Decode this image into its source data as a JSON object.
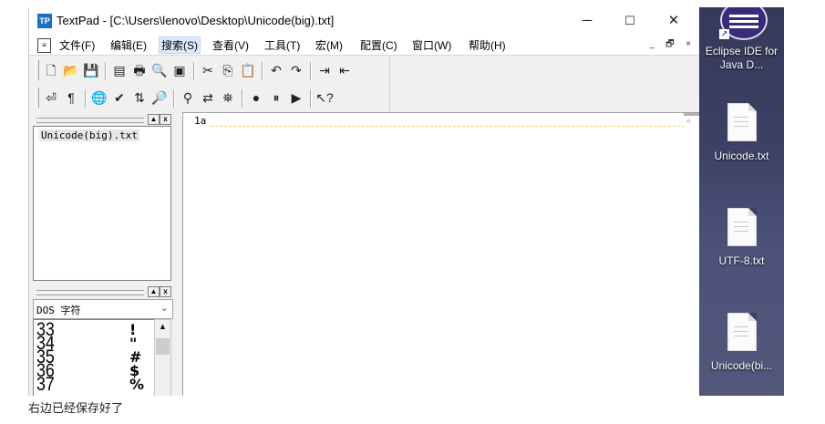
{
  "window": {
    "title": "TextPad - [C:\\Users\\lenovo\\Desktop\\Unicode(big).txt]",
    "app_icon": "TP",
    "min_glyph": "─",
    "max_glyph": "☐",
    "close_glyph": "✕"
  },
  "menu": {
    "items": [
      "文件(F)",
      "编辑(E)",
      "搜索(S)",
      "查看(V)",
      "工具(T)",
      "宏(M)",
      "配置(C)",
      "窗口(W)",
      "帮助(H)"
    ],
    "active": "搜索(S)",
    "mdi_min": "_",
    "mdi_restore": "🗗",
    "mdi_close": "×"
  },
  "toolbar": {
    "row1": [
      {
        "name": "new-file-icon",
        "glyph": "🗋"
      },
      {
        "name": "open-file-icon",
        "glyph": "📂"
      },
      {
        "name": "save-icon",
        "glyph": "💾"
      },
      {
        "name": "save-all-icon",
        "glyph": "▤"
      },
      {
        "name": "print-icon",
        "glyph": "🖶"
      },
      {
        "name": "print-preview-icon",
        "glyph": "🔍"
      },
      {
        "name": "workspace-icon",
        "glyph": "▣"
      },
      {
        "name": "cut-icon",
        "glyph": "✂"
      },
      {
        "name": "copy-icon",
        "glyph": "⎘"
      },
      {
        "name": "paste-icon",
        "glyph": "📋"
      },
      {
        "name": "undo-icon",
        "glyph": "↶"
      },
      {
        "name": "redo-icon",
        "glyph": "↷"
      },
      {
        "name": "indent-icon",
        "glyph": "⇥"
      },
      {
        "name": "outdent-icon",
        "glyph": "⇤"
      }
    ],
    "row2": [
      {
        "name": "word-wrap-icon",
        "glyph": "⏎"
      },
      {
        "name": "show-paragraph-icon",
        "glyph": "¶"
      },
      {
        "name": "web-browser-icon",
        "glyph": "🌐"
      },
      {
        "name": "spell-check-icon",
        "glyph": "✔"
      },
      {
        "name": "sort-icon",
        "glyph": "⇅"
      },
      {
        "name": "find-in-files-icon",
        "glyph": "🔎"
      },
      {
        "name": "find-icon",
        "glyph": "⚲"
      },
      {
        "name": "replace-icon",
        "glyph": "⇄"
      },
      {
        "name": "binoculars-icon",
        "glyph": "⛯"
      },
      {
        "name": "record-macro-icon",
        "glyph": "●"
      },
      {
        "name": "pause-macro-icon",
        "glyph": "⏸"
      },
      {
        "name": "play-macro-icon",
        "glyph": "▶"
      },
      {
        "name": "context-help-icon",
        "glyph": "↖?"
      }
    ]
  },
  "file_pane": {
    "btn_up": "▲",
    "btn_close": "x",
    "files": [
      "Unicode(big).txt"
    ]
  },
  "clip_pane": {
    "btn_up": "▲",
    "btn_close": "x",
    "selected": "DOS 字符",
    "dropdown_arrow": "⌄",
    "rows": [
      {
        "code": "33",
        "char": "!"
      },
      {
        "code": "34",
        "char": "\""
      },
      {
        "code": "35",
        "char": "#"
      },
      {
        "code": "36",
        "char": "$"
      },
      {
        "code": "37",
        "char": "%"
      }
    ],
    "scroll_up": "▲"
  },
  "editor": {
    "lines": [
      "1a"
    ],
    "scroll_up": "^"
  },
  "desktop": {
    "icons": [
      {
        "label": "Eclipse IDE\nfor Java D...",
        "short": "Eclipse IDE for Java D..."
      },
      {
        "label": "Unicode.txt"
      },
      {
        "label": "UTF-8.txt"
      },
      {
        "label": "Unicode(bi..."
      }
    ],
    "shortcut_arrow": "↗"
  },
  "caption": "右边已经保存好了",
  "colors": {
    "desktop_bg": "#3c4064",
    "menu_active": "#dcebfc",
    "eclipse_purple": "#3b2a79"
  }
}
